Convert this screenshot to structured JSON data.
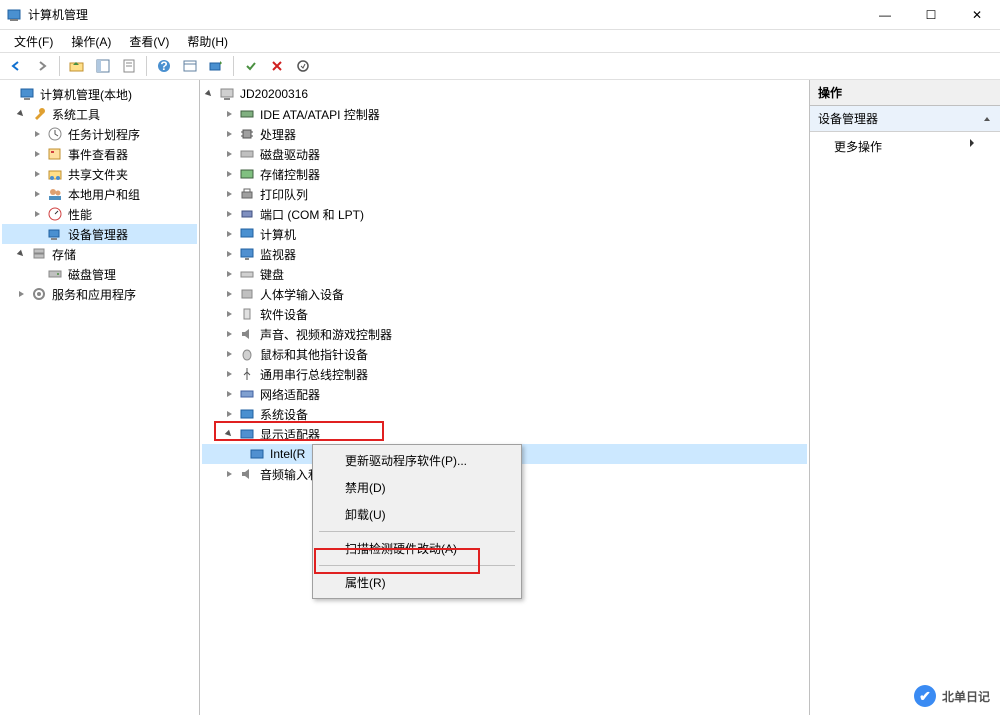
{
  "window": {
    "title": "计算机管理",
    "minimize": "—",
    "maximize": "☐",
    "close": "✕"
  },
  "menubar": {
    "file": "文件(F)",
    "action": "操作(A)",
    "view": "查看(V)",
    "help": "帮助(H)"
  },
  "left_tree": {
    "root": "计算机管理(本地)",
    "system_tools": "系统工具",
    "task_scheduler": "任务计划程序",
    "event_viewer": "事件查看器",
    "shared_folders": "共享文件夹",
    "local_users": "本地用户和组",
    "performance": "性能",
    "device_manager": "设备管理器",
    "storage": "存储",
    "disk_management": "磁盘管理",
    "services": "服务和应用程序"
  },
  "center_tree": {
    "computer": "JD20200316",
    "ide": "IDE ATA/ATAPI 控制器",
    "processors": "处理器",
    "disk_drives": "磁盘驱动器",
    "storage_ctrl": "存储控制器",
    "print_queue": "打印队列",
    "ports": "端口 (COM 和 LPT)",
    "computers": "计算机",
    "monitors": "监视器",
    "keyboards": "键盘",
    "hid": "人体学输入设备",
    "software": "软件设备",
    "sound": "声音、视频和游戏控制器",
    "mice": "鼠标和其他指针设备",
    "usb": "通用串行总线控制器",
    "network": "网络适配器",
    "system": "系统设备",
    "display": "显示适配器",
    "intel": "Intel(R",
    "audio_io": "音频输入和"
  },
  "context_menu": {
    "update_driver": "更新驱动程序软件(P)...",
    "disable": "禁用(D)",
    "uninstall": "卸载(U)",
    "scan": "扫描检测硬件改动(A)",
    "properties": "属性(R)"
  },
  "right_pane": {
    "header": "操作",
    "sub": "设备管理器",
    "more": "更多操作"
  },
  "watermark": "北单日记"
}
